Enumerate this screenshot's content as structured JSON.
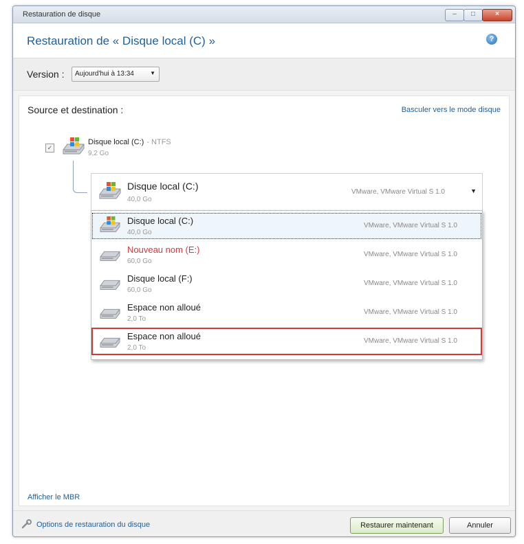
{
  "window": {
    "title": "Restauration de disque",
    "minimize": "–",
    "maximize": "□",
    "close": "×"
  },
  "header": {
    "title": "Restauration de « Disque local (C) »",
    "help": "?"
  },
  "version": {
    "label": "Version :",
    "value": "Aujourd'hui à 13:34"
  },
  "panel": {
    "section_title": "Source et destination :",
    "switch_link": "Basculer vers le mode disque",
    "source": {
      "checked": "✓",
      "name": "Disque local (C:)",
      "fs": "- NTFS",
      "size": "9,2 Go"
    },
    "combo": {
      "name": "Disque local (C:)",
      "size": "40,0 Go",
      "vendor": "VMware, VMware Virtual S 1.0"
    },
    "options": [
      {
        "name": "Disque local (C:)",
        "size": "40,0 Go",
        "vendor": "VMware, VMware Virtual S 1.0",
        "icon": "windows-drive-icon"
      },
      {
        "name": "Nouveau nom (E:)",
        "size": "60,0 Go",
        "vendor": "VMware, VMware Virtual S 1.0",
        "icon": "drive-icon"
      },
      {
        "name": "Disque local (F:)",
        "size": "60,0 Go",
        "vendor": "VMware, VMware Virtual S 1.0",
        "icon": "drive-icon"
      },
      {
        "name": "Espace non alloué",
        "size": "2,0 To",
        "vendor": "VMware, VMware Virtual S 1.0",
        "icon": "drive-icon"
      },
      {
        "name": "Espace non alloué",
        "size": "2,0 To",
        "vendor": "VMware, VMware Virtual S 1.0",
        "icon": "drive-icon"
      }
    ],
    "mbr_link": "Afficher le MBR"
  },
  "footer": {
    "options_link": "Options de restauration du disque",
    "restore_button": "Restaurer maintenant",
    "cancel_button": "Annuler"
  },
  "colors": {
    "accent": "#1f5f9a",
    "selected_outline": "#d23a3a",
    "highlight_name": "#d23a3a"
  }
}
